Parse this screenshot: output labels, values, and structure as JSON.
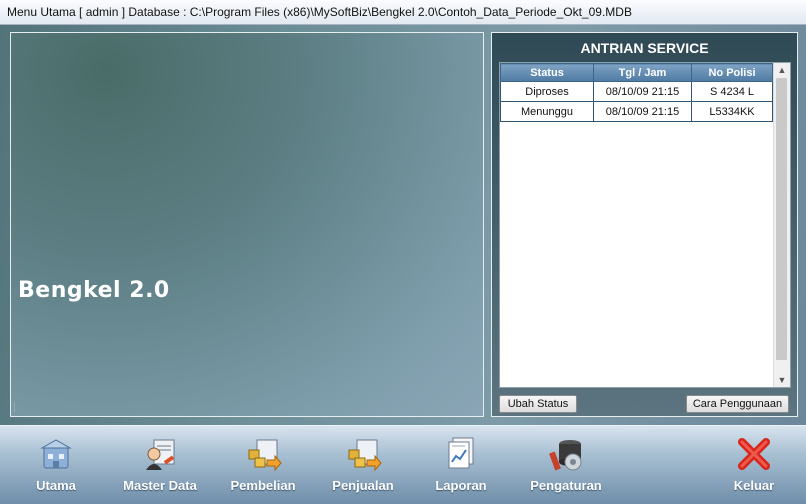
{
  "window": {
    "title": "Menu Utama [ admin ] Database : C:\\Program Files (x86)\\MySoftBiz\\Bengkel 2.0\\Contoh_Data_Periode_Okt_09.MDB"
  },
  "hero": {
    "app_name": "Bengkel 2.0"
  },
  "queue": {
    "title": "ANTRIAN SERVICE",
    "columns": [
      "Status",
      "Tgl / Jam",
      "No Polisi"
    ],
    "rows": [
      [
        "Diproses",
        "08/10/09 21:15",
        "S 4234 L"
      ],
      [
        "Menunggu",
        "08/10/09 21:15",
        "L5334KK"
      ]
    ],
    "change_status_label": "Ubah Status",
    "help_label": "Cara Penggunaan"
  },
  "toolbar": {
    "items": [
      {
        "label": "Utama",
        "icon": "home-building-icon"
      },
      {
        "label": "Master Data",
        "icon": "master-data-icon"
      },
      {
        "label": "Pembelian",
        "icon": "purchase-icon"
      },
      {
        "label": "Penjualan",
        "icon": "sales-icon"
      },
      {
        "label": "Laporan",
        "icon": "report-icon"
      },
      {
        "label": "Pengaturan",
        "icon": "settings-icon"
      },
      {
        "label": "Keluar",
        "icon": "exit-icon"
      }
    ]
  },
  "colors": {
    "accent": "#4f7aa3",
    "exit": "#d9261c"
  }
}
